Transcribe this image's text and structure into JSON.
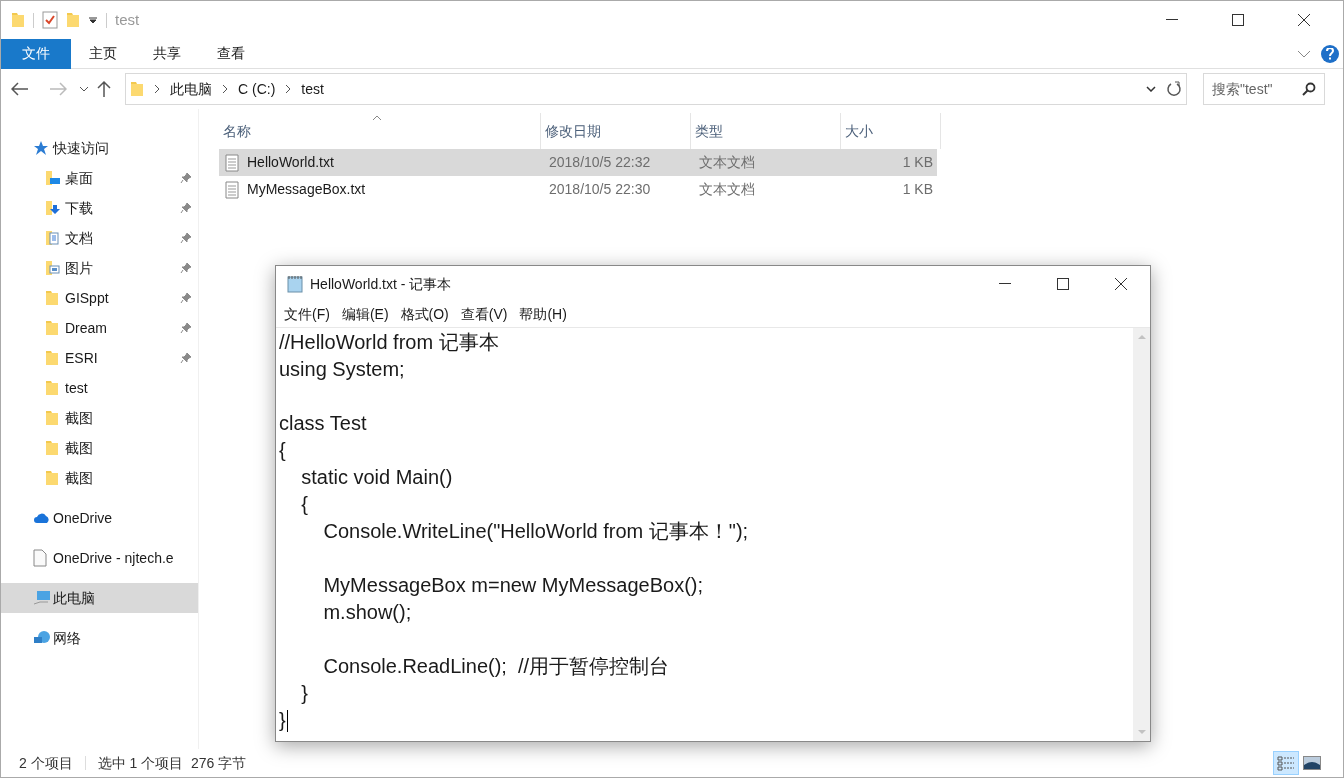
{
  "explorer": {
    "title": "test",
    "ribbon_tabs": [
      {
        "label": "文件",
        "selected": true
      },
      {
        "label": "主页",
        "selected": false
      },
      {
        "label": "共享",
        "selected": false
      },
      {
        "label": "查看",
        "selected": false
      }
    ],
    "breadcrumb": [
      "此电脑",
      "C (C:)",
      "test"
    ],
    "search": {
      "placeholder": "搜索\"test\""
    },
    "sidebar": [
      {
        "label": "快速访问",
        "kind": "star",
        "selected": false,
        "children": [
          {
            "label": "桌面",
            "kind": "desktop",
            "pinned": true,
            "selected": false
          },
          {
            "label": "下载",
            "kind": "download",
            "pinned": true,
            "selected": false
          },
          {
            "label": "文档",
            "kind": "documents",
            "pinned": true,
            "selected": false
          },
          {
            "label": "图片",
            "kind": "pictures",
            "pinned": true,
            "selected": false
          },
          {
            "label": "GISppt",
            "kind": "folder",
            "pinned": true,
            "selected": false
          },
          {
            "label": "Dream",
            "kind": "folder",
            "pinned": true,
            "selected": false
          },
          {
            "label": "ESRI",
            "kind": "folder",
            "pinned": true,
            "selected": false
          },
          {
            "label": "test",
            "kind": "folder",
            "pinned": false,
            "selected": false
          },
          {
            "label": "截图",
            "kind": "folder",
            "pinned": false,
            "selected": false
          },
          {
            "label": "截图",
            "kind": "folder",
            "pinned": false,
            "selected": false
          },
          {
            "label": "截图",
            "kind": "folder",
            "pinned": false,
            "selected": false
          }
        ]
      },
      {
        "label": "OneDrive",
        "kind": "cloud",
        "selected": false
      },
      {
        "label": "OneDrive - njtech.e",
        "kind": "file",
        "selected": false
      },
      {
        "label": "此电脑",
        "kind": "pc",
        "selected": true
      },
      {
        "label": "网络",
        "kind": "network",
        "selected": false
      }
    ],
    "table": {
      "columns": [
        "名称",
        "修改日期",
        "类型",
        "大小"
      ],
      "rows": [
        {
          "name": "HelloWorld.txt",
          "date": "2018/10/5 22:32",
          "type": "文本文档",
          "size": "1 KB",
          "selected": true
        },
        {
          "name": "MyMessageBox.txt",
          "date": "2018/10/5 22:30",
          "type": "文本文档",
          "size": "1 KB",
          "selected": false
        }
      ]
    },
    "status_bar": {
      "count": "2 个项目",
      "selection": "选中 1 个项目  276 字节"
    },
    "view_buttons": [
      {
        "kind": "details",
        "selected": true
      },
      {
        "kind": "thumbnails",
        "selected": false
      }
    ]
  },
  "notepad": {
    "title": "HelloWorld.txt - 记事本",
    "menu": [
      "文件(F)",
      "编辑(E)",
      "格式(O)",
      "查看(V)",
      "帮助(H)"
    ],
    "text": "//HelloWorld from 记事本\nusing System;\n\nclass Test\n{\n    static void Main()\n    {\n        Console.WriteLine(\"HelloWorld from 记事本！\");\n\n        MyMessageBox m=new MyMessageBox();\n        m.show();\n\n        Console.ReadLine();  //用于暂停控制台\n    }\n}"
  }
}
